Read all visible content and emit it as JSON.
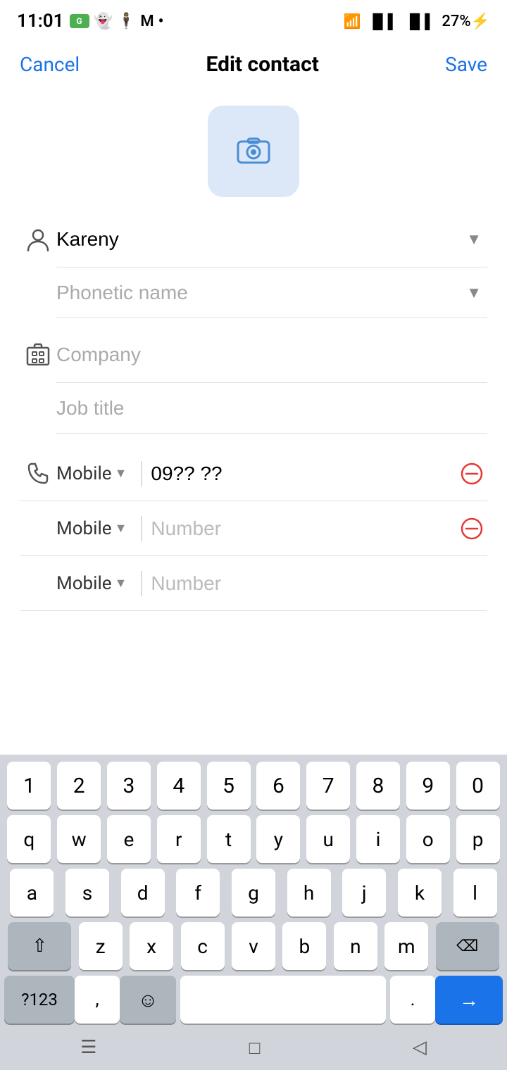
{
  "statusBar": {
    "time": "11:01",
    "battery": "27%",
    "batteryCharging": true
  },
  "header": {
    "cancelLabel": "Cancel",
    "title": "Edit contact",
    "saveLabel": "Save"
  },
  "form": {
    "namePlaceholder": "Kareny",
    "nameValue": "Kareny",
    "phoneticNamePlaceholder": "Phonetic name",
    "companyPlaceholder": "Company",
    "jobTitlePlaceholder": "Job title",
    "phone": {
      "label": "Mobile",
      "number1": "09?? ??",
      "number1Placeholder": "",
      "number2": "",
      "number2Placeholder": "Number",
      "number3": "",
      "number3Placeholder": "Number"
    }
  },
  "keyboard": {
    "numbers": [
      "1",
      "2",
      "3",
      "4",
      "5",
      "6",
      "7",
      "8",
      "9",
      "0"
    ],
    "row1": [
      "q",
      "w",
      "e",
      "r",
      "t",
      "y",
      "u",
      "i",
      "o",
      "p"
    ],
    "row2": [
      "a",
      "s",
      "d",
      "f",
      "g",
      "h",
      "j",
      "k",
      "l"
    ],
    "row3": [
      "z",
      "x",
      "c",
      "v",
      "b",
      "n",
      "m"
    ],
    "specialKeys": {
      "shift": "⇧",
      "backspace": "⌫",
      "numeric": "?123",
      "comma": ",",
      "emoji": "☺",
      "dot": ".",
      "enter": "→"
    }
  },
  "navBar": {
    "menuIcon": "☰",
    "homeIcon": "□",
    "backIcon": "◁"
  }
}
